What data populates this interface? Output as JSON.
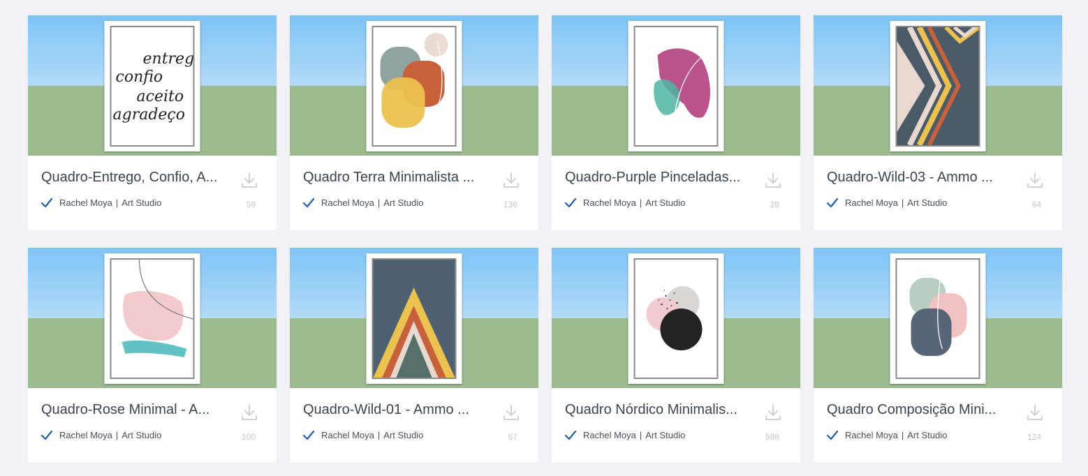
{
  "colors": {
    "page_bg": "#f2f2f6",
    "card_bg": "#ffffff",
    "sky": "#7ec4f6",
    "ground": "#9bbb8f",
    "check": "#1d5fa8",
    "icon_gray": "#c9ccd1"
  },
  "icons": {
    "download": "download-icon",
    "verified": "check-icon"
  },
  "cards": [
    {
      "title": "Quadro-Entrego, Confio, A...",
      "author": "Rachel Moya",
      "studio": "Art Studio",
      "downloads": "59",
      "artwork": "calligraphy-entrego-confio-aceito-agradeco"
    },
    {
      "title": "Quadro Terra Minimalista ...",
      "author": "Rachel Moya",
      "studio": "Art Studio",
      "downloads": "136",
      "artwork": "terra-minimal-shapes"
    },
    {
      "title": "Quadro-Purple Pinceladas...",
      "author": "Rachel Moya",
      "studio": "Art Studio",
      "downloads": "28",
      "artwork": "purple-brushstrokes"
    },
    {
      "title": "Quadro-Wild-03 - Ammo ...",
      "author": "Rachel Moya",
      "studio": "Art Studio",
      "downloads": "64",
      "artwork": "wild-03-zigzag"
    },
    {
      "title": "Quadro-Rose Minimal - A...",
      "author": "Rachel Moya",
      "studio": "Art Studio",
      "downloads": "100",
      "artwork": "rose-minimal"
    },
    {
      "title": "Quadro-Wild-01 - Ammo ...",
      "author": "Rachel Moya",
      "studio": "Art Studio",
      "downloads": "67",
      "artwork": "wild-01-chevron"
    },
    {
      "title": "Quadro Nórdico Minimalis...",
      "author": "Rachel Moya",
      "studio": "Art Studio",
      "downloads": "598",
      "artwork": "nordic-minimal-circles"
    },
    {
      "title": "Quadro Composição Mini...",
      "author": "Rachel Moya",
      "studio": "Art Studio",
      "downloads": "124",
      "artwork": "composition-minimal"
    }
  ],
  "artwork_text": {
    "calligraphy": [
      "entrego",
      "confio",
      "aceito",
      "agradeço"
    ]
  }
}
